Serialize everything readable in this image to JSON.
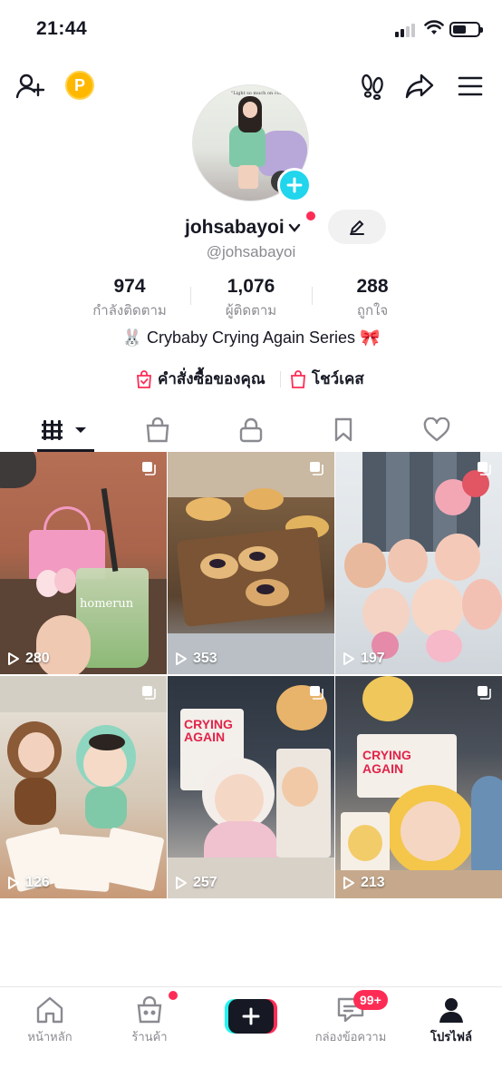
{
  "status_bar": {
    "time": "21:44"
  },
  "profile": {
    "username": "johsabayoi",
    "handle": "@johsabayoi",
    "avatar_wall_text": "\"Light so much on coffee.\"",
    "stats": [
      {
        "value": "974",
        "label": "กำลังติดตาม"
      },
      {
        "value": "1,076",
        "label": "ผู้ติดตาม"
      },
      {
        "value": "288",
        "label": "ถูกใจ"
      }
    ],
    "bio": "🐰 Crybaby Crying Again Series 🎀",
    "links": [
      {
        "label": "คำสั่งซื้อของคุณ"
      },
      {
        "label": "โชว์เคส"
      }
    ]
  },
  "top_bar": {
    "coin_label": "P"
  },
  "tabs": [
    "videos-grid-tab",
    "shop-tab",
    "private-tab",
    "saved-tab",
    "liked-tab"
  ],
  "videos": [
    {
      "views": "280",
      "overlay_text": "homerun"
    },
    {
      "views": "353"
    },
    {
      "views": "197"
    },
    {
      "views": "126"
    },
    {
      "views": "257",
      "overlay_text": "CRYING AGAIN"
    },
    {
      "views": "213",
      "overlay_text": "CRYING AGAIN"
    }
  ],
  "bottom_nav": {
    "items": [
      {
        "label": "หน้าหลัก"
      },
      {
        "label": "ร้านค้า"
      },
      {
        "label": ""
      },
      {
        "label": "กล่องข้อความ"
      },
      {
        "label": "โปรไฟล์"
      }
    ],
    "inbox_badge": "99+"
  },
  "colors": {
    "accent": "#fe2c55",
    "cyan": "#20d5ec",
    "coin": "#ffb800",
    "text": "#161823",
    "muted": "#8a8b91"
  }
}
